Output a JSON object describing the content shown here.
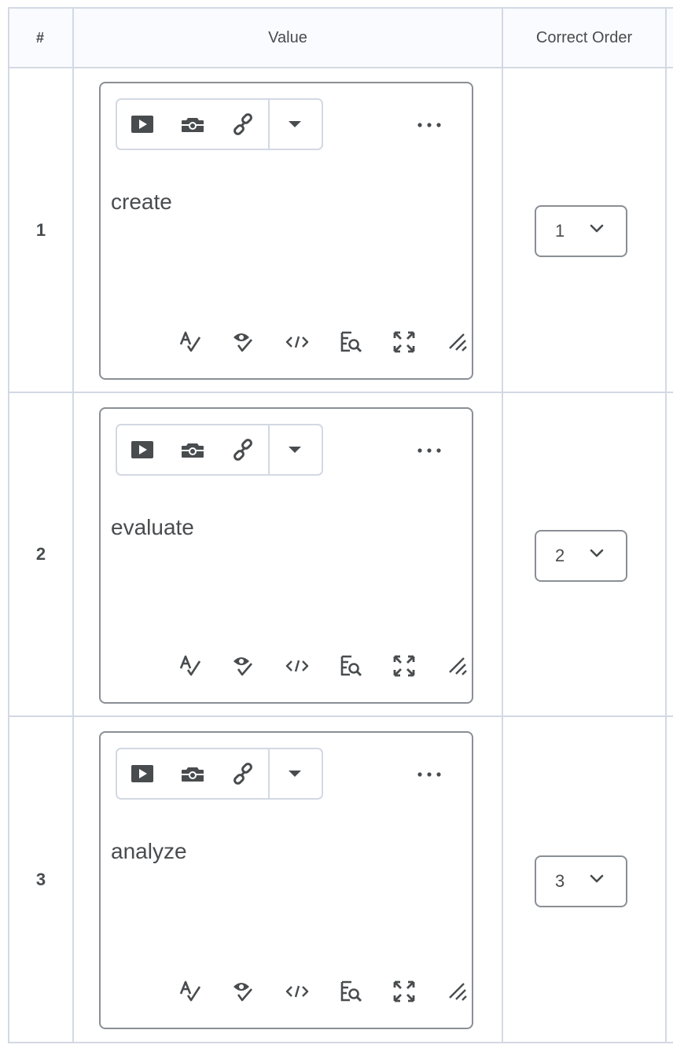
{
  "table": {
    "headers": {
      "index": "#",
      "value": "Value",
      "order": "Correct Order"
    },
    "rows": [
      {
        "index": "1",
        "text": "create",
        "order": "1"
      },
      {
        "index": "2",
        "text": "evaluate",
        "order": "2"
      },
      {
        "index": "3",
        "text": "analyze",
        "order": "3"
      }
    ]
  },
  "editor_toolbar": {
    "buttons": [
      "video-icon",
      "camera-icon",
      "link-icon",
      "dropdown-caret-icon",
      "more-icon"
    ]
  },
  "editor_footer": {
    "buttons": [
      "spellcheck-icon",
      "accessibility-check-icon",
      "source-code-icon",
      "find-icon",
      "fullscreen-icon",
      "resize-handle-icon"
    ]
  },
  "colors": {
    "text": "#494c4e",
    "border": "#8a8f94",
    "grid": "#d3d9e3",
    "header_bg": "#f9fbff"
  }
}
